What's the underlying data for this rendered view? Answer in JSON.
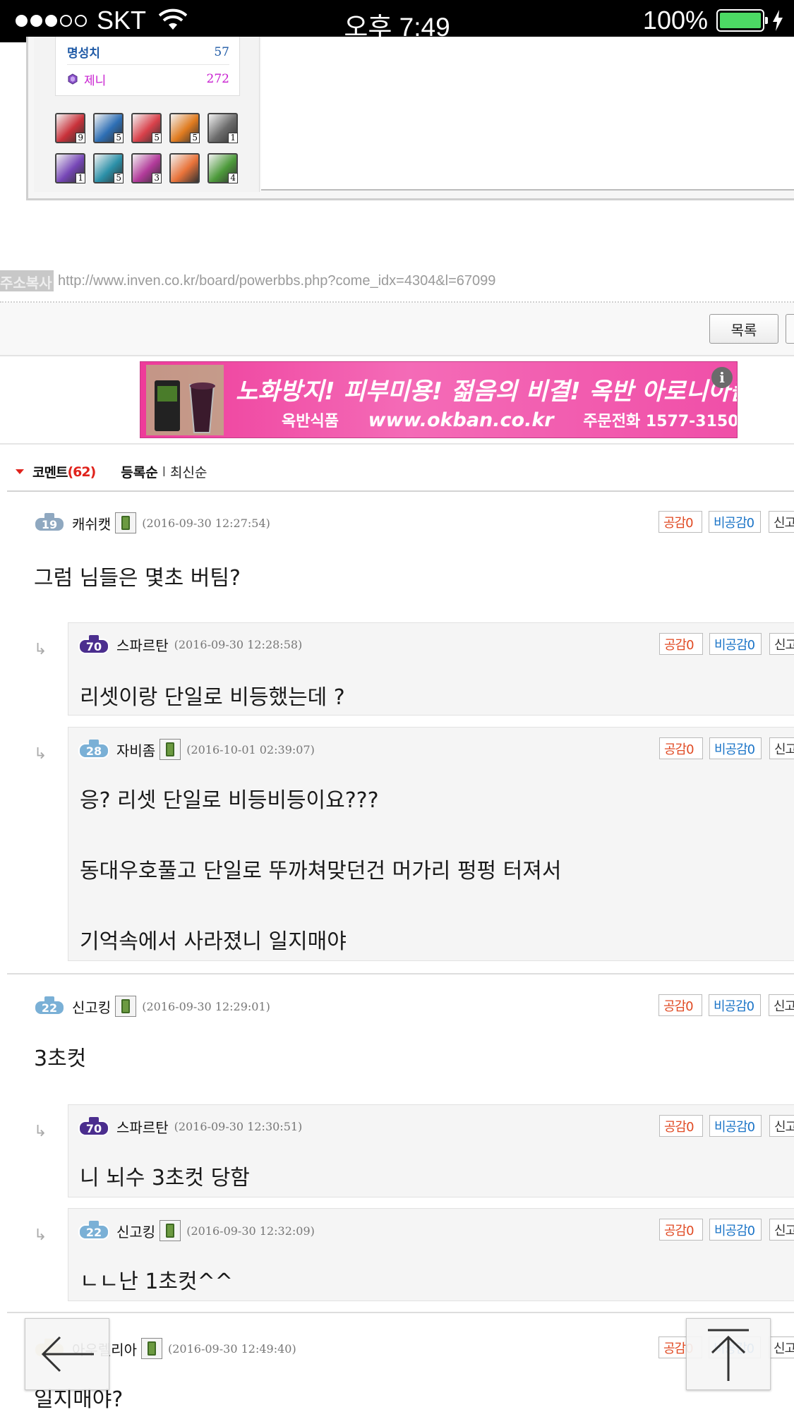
{
  "status_bar": {
    "carrier": "SKT",
    "time": "오후 7:49",
    "battery": "100%",
    "signal_bars_filled": 3,
    "signal_bars_total": 5
  },
  "profile": {
    "stats": [
      {
        "label": "명성치",
        "value": "57"
      },
      {
        "label": "제니",
        "value": "272"
      }
    ],
    "items": [
      {
        "icon": "item-red-box-icon",
        "count": "9",
        "color": "#c9313a"
      },
      {
        "icon": "item-blue-card-icon",
        "count": "5",
        "color": "#2e6fb5"
      },
      {
        "icon": "item-gift-icon",
        "count": "5",
        "color": "#d9414b"
      },
      {
        "icon": "item-orange-box-icon",
        "count": "5",
        "color": "#e07b1f"
      },
      {
        "icon": "item-grey-gem-icon",
        "count": "1",
        "color": "#6b6b6b"
      },
      {
        "icon": "item-purple-ticket-icon",
        "count": "1",
        "color": "#7646b7"
      },
      {
        "icon": "item-teal-star-icon",
        "count": "5",
        "color": "#2b90a8"
      },
      {
        "icon": "item-magenta-sparkle-icon",
        "count": "3",
        "color": "#b23a9a"
      },
      {
        "icon": "item-notebook-icon",
        "count": "",
        "color": "#e9733a"
      },
      {
        "icon": "item-green-leaf-icon",
        "count": "4",
        "color": "#4c9a3a"
      }
    ]
  },
  "url_bar": {
    "copy_label": "주소복사",
    "url": "http://www.inven.co.kr/board/powerbbs.php?come_idx=4304&l=67099"
  },
  "toolbar": {
    "list_label": "목록"
  },
  "ad": {
    "headline": "노화방지! 피부미용! 젊음의 비결! 옥반 아로니아즙!",
    "brand": "옥반식품",
    "url": "www.okban.co.kr",
    "phone": "주문전화 1577-3150",
    "info_icon": "i"
  },
  "comments_header": {
    "title": "코멘트",
    "count": "(62)",
    "sort_registered": "등록순",
    "sort_separator": "l",
    "sort_latest": "최신순"
  },
  "vote_labels": {
    "like": "공감0",
    "dislike": "비공감0",
    "report": "신고"
  },
  "comments": [
    {
      "level": "19",
      "nick": "캐쉬캣",
      "mobile": true,
      "date": "(2016-09-30 12:27:54)",
      "lines": [
        "그럼 님들은 몇초 버팀?"
      ],
      "reply": false
    },
    {
      "level": "70",
      "nick": "스파르탄",
      "mobile": false,
      "date": "(2016-09-30 12:28:58)",
      "lines": [
        "리셋이랑 단일로 비등했는데 ?"
      ],
      "reply": true
    },
    {
      "level": "28",
      "nick": "자비좀",
      "mobile": true,
      "date": "(2016-10-01 02:39:07)",
      "lines": [
        "응? 리셋 단일로 비등비등이요???",
        "동대우호풀고 단일로 뚜까쳐맞던건 머가리 펑펑 터져서",
        "기억속에서 사라졌니 일지매야"
      ],
      "reply": true
    },
    {
      "level": "22",
      "nick": "신고킹",
      "mobile": true,
      "date": "(2016-09-30 12:29:01)",
      "lines": [
        "3초컷"
      ],
      "reply": false
    },
    {
      "level": "70",
      "nick": "스파르탄",
      "mobile": false,
      "date": "(2016-09-30 12:30:51)",
      "lines": [
        "니 뇌수 3초컷 당함"
      ],
      "reply": true
    },
    {
      "level": "22",
      "nick": "신고킹",
      "mobile": true,
      "date": "(2016-09-30 12:32:09)",
      "lines": [
        "ㄴㄴ난 1초컷^^"
      ],
      "reply": true
    },
    {
      "level": "",
      "nick": "아우렐리아",
      "mobile": true,
      "date": "(2016-09-30 12:49:40)",
      "lines": [
        "일지매야?"
      ],
      "reply": false
    }
  ],
  "reply_arrow": "↳",
  "colors": {
    "accent_red": "#e0231c",
    "like_color": "#e04a23",
    "dislike_color": "#1b74c7",
    "ad_pink": "#ee3b9a"
  }
}
